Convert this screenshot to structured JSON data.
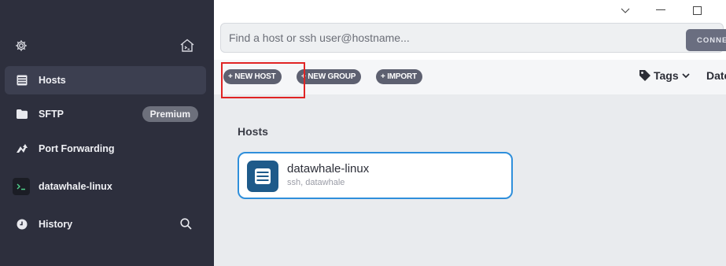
{
  "sidebar": {
    "items": [
      {
        "label": "Hosts",
        "icon": "hosts-icon",
        "active": true
      },
      {
        "label": "SFTP",
        "icon": "folder-icon",
        "badge": "Premium"
      },
      {
        "label": "Port Forwarding",
        "icon": "port-forwarding-icon"
      },
      {
        "label": "datawhale-linux",
        "icon": "terminal-icon"
      },
      {
        "label": "History",
        "icon": "history-icon"
      }
    ]
  },
  "search": {
    "placeholder": "Find a host or ssh user@hostname...",
    "connect_label": "CONNECT"
  },
  "toolbar": {
    "new_host": "+ NEW HOST",
    "new_group": "+ NEW GROUP",
    "import": "+ IMPORT",
    "tags": "Tags",
    "date": "Date"
  },
  "hosts_section": {
    "title": "Hosts",
    "cards": [
      {
        "name": "datawhale-linux",
        "subtitle": "ssh, datawhale"
      }
    ]
  },
  "colors": {
    "sidebar_bg": "#2d2f3d",
    "accent_blue": "#2f8fdb",
    "highlight_red": "#e02424",
    "host_icon_bg": "#1e5a8a"
  }
}
